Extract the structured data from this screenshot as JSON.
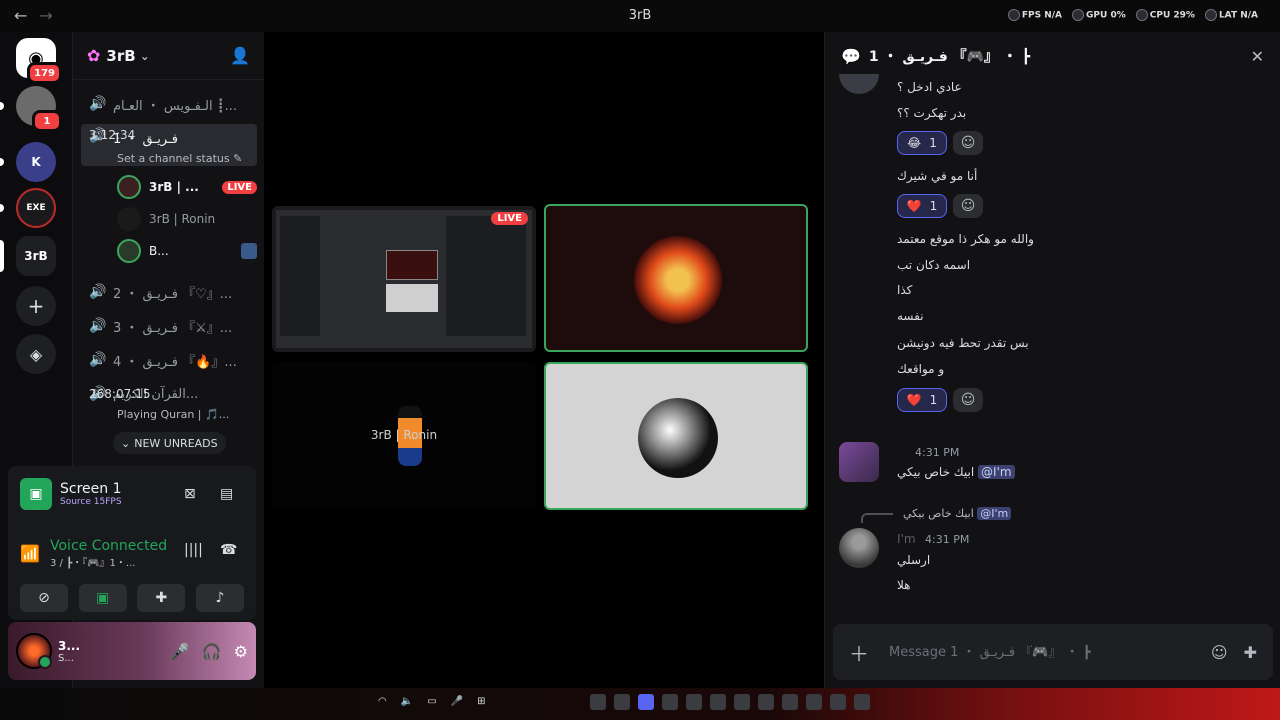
{
  "topbar": {
    "back": "←",
    "forward": "→",
    "title": "3rB",
    "stats": [
      "FPS N/A",
      "GPU 0%",
      "CPU 29%",
      "LAT N/A"
    ]
  },
  "rail": {
    "home_badge": "179",
    "server2_badge": "1",
    "server_label": "3rB",
    "server_exe": "EXE"
  },
  "sidebar": {
    "server_name": "3rB",
    "channels": [
      {
        "label": "الـفـويس ・ العـام ┋..."
      },
      {
        "label": "1 ・ فـريـق",
        "time": "3:12:34",
        "status": "Set a channel status ✎"
      },
      {
        "label": "2 ・ فـريـق 『♡』..."
      },
      {
        "label": "3 ・ فـريـق 『⚔』..."
      },
      {
        "label": "4 ・ فـريـق 『🔥』..."
      },
      {
        "label": "القرآن الكريم...",
        "time": "268:07:15",
        "status": "Playing Quran | 🎵..."
      }
    ],
    "voice_users": [
      {
        "name": "3rB | ...",
        "live": "LIVE"
      },
      {
        "name": "3rB | Ronin"
      },
      {
        "name": "B..."
      }
    ],
    "new_unreads": "NEW UNREADS"
  },
  "voicepanel": {
    "screen_title": "Screen 1",
    "screen_sub": "Source 15FPS",
    "conn_title": "Voice Connected",
    "conn_sub": "3 / ┣・『🎮』1・..."
  },
  "user": {
    "name": "3...",
    "status": "S..."
  },
  "stage": {
    "live": "LIVE",
    "ronin_name": "3rB | Ronin"
  },
  "chat": {
    "title": "1 ・ فـريـق 『🎮』 ・ ┣",
    "messages": [
      "عادي ادخل ؟",
      "بدر تهكرت ؟؟",
      "أنا مو في شيرك",
      "والله مو هكر ذا موقع معتمد",
      "اسمه دكان تب",
      "كذا",
      "نفسه",
      "بس تقدر تحط فيه دونيشن",
      "و مواقعك"
    ],
    "reactions": [
      {
        "emoji": "😂",
        "count": "1"
      },
      {
        "emoji": "❤️",
        "count": "1"
      },
      {
        "emoji": "❤️",
        "count": "1"
      }
    ],
    "msg2_time": "4:31 PM",
    "msg2_text": "ابيك خاص بيكي",
    "msg2_mention": "@I'm",
    "reply_text": "ابيك خاص بيكي",
    "reply_mention": "@I'm",
    "msg3_author": "I'm",
    "msg3_time": "4:31 PM",
    "msg3_lines": [
      "ارسلي",
      "هلا"
    ],
    "input_placeholder": "Message 1 ・ فـريـق 『🎮』 ・ ┣"
  },
  "colors": {
    "accent": "#5865f2",
    "online": "#23a55a",
    "live": "#f23f42"
  }
}
